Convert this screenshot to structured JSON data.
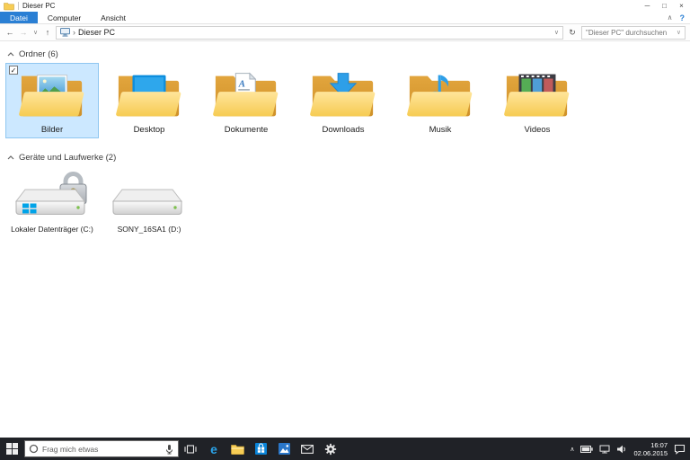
{
  "window": {
    "title": "Dieser PC"
  },
  "icons": {
    "minimize": "─",
    "maximize": "□",
    "close": "×",
    "back": "←",
    "forward": "→",
    "down_chevron": "∨",
    "up": "↑",
    "refresh": "↻",
    "crumb_chevron": "›",
    "ribbon_collapse": "∧",
    "help": "?",
    "tray_expand": "∧",
    "check": "✓",
    "edge_glyph": "e"
  },
  "colors": {
    "file_tab_blue": "#2a7fd4",
    "selection_bg": "#cce8ff",
    "selection_border": "#8fc6f0",
    "folder_yellow": "#f7cd55",
    "accent_blue": "#2e9fe8",
    "taskbar_bg": "#202227"
  },
  "ribbon": {
    "tabs": [
      {
        "label": "Datei",
        "highlight": true
      },
      {
        "label": "Computer"
      },
      {
        "label": "Ansicht"
      }
    ]
  },
  "addressbar": {
    "location": "Dieser PC",
    "search_placeholder": "\"Dieser PC\" durchsuchen"
  },
  "content": {
    "groups": [
      {
        "label": "Ordner (6)",
        "items": [
          {
            "label": "Bilder",
            "selected": true
          },
          {
            "label": "Desktop"
          },
          {
            "label": "Dokumente"
          },
          {
            "label": "Downloads"
          },
          {
            "label": "Musik"
          },
          {
            "label": "Videos"
          }
        ]
      },
      {
        "label": "Geräte und Laufwerke (2)",
        "items": [
          {
            "label": "Lokaler Datenträger (C:)"
          },
          {
            "label": "SONY_16SA1 (D:)"
          }
        ]
      }
    ]
  },
  "taskbar": {
    "search_placeholder": "Frag mich etwas",
    "clock": {
      "time": "16:07",
      "date": "02.06.2015"
    }
  }
}
